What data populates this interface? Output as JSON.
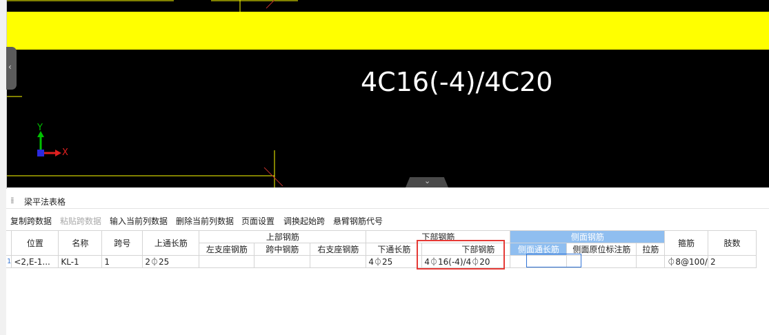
{
  "viewport": {
    "annotation": "4C16(-4)/4C20",
    "axis_x": "X",
    "axis_y": "Y",
    "beam_color": "#ffff00",
    "collapse_glyph": "‹",
    "handle_glyph": "⌄"
  },
  "panel": {
    "title": "梁平法表格",
    "toolbar": [
      "复制跨数据",
      "粘贴跨数据",
      "输入当前列数据",
      "删除当前列数据",
      "页面设置",
      "调换起始跨",
      "悬臂钢筋代号"
    ],
    "toolbar_disabled": [
      1
    ]
  },
  "table": {
    "group_headers": {
      "top_rebar": "上部钢筋",
      "bottom_rebar": "下部钢筋",
      "side_rebar": "侧面钢筋"
    },
    "headers": {
      "position": "位置",
      "name": "名称",
      "span_no": "跨号",
      "top_through": "上通长筋",
      "left_support": "左支座钢筋",
      "mid_span": "跨中钢筋",
      "right_support": "右支座钢筋",
      "bottom_through": "下通长筋",
      "bottom_rebar": "下部钢筋",
      "side_through": "侧面通长筋",
      "side_origin": "侧面原位标注筋",
      "tie": "拉筋",
      "stirrup": "箍筋",
      "legs": "肢数"
    },
    "row": {
      "rownum": "1",
      "position": "<2,E-1...",
      "name": "KL-1",
      "span_no": "1",
      "top_through": "2⏀25",
      "left_support": "",
      "mid_span": "",
      "right_support": "",
      "bottom_through": "4⏀25",
      "bottom_rebar": "4⏀16(-4)/4⏀20",
      "side_through": "",
      "side_origin": "",
      "tie": "",
      "stirrup": "⏀8@100/",
      "legs": "2"
    }
  }
}
